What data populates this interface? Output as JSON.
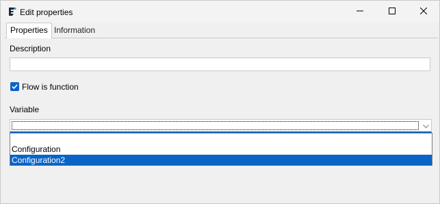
{
  "window": {
    "title": "Edit properties",
    "icon": "app-logo-icon",
    "controls": {
      "minimize": "minimize-icon",
      "maximize": "maximize-icon",
      "close": "close-icon"
    }
  },
  "tabs": [
    {
      "label": "Properties",
      "active": true
    },
    {
      "label": "Information",
      "active": false
    }
  ],
  "form": {
    "description": {
      "label": "Description",
      "value": ""
    },
    "flow_is_function": {
      "label": "Flow is function",
      "checked": true
    },
    "variable": {
      "label": "Variable",
      "selected_value": "",
      "options": [
        "",
        "Configuration",
        "Configuration2"
      ],
      "highlighted": "Configuration2"
    }
  },
  "colors": {
    "accent": "#0a64c8",
    "window_bg": "#f0f0f0",
    "input_bg": "#ffffff"
  }
}
